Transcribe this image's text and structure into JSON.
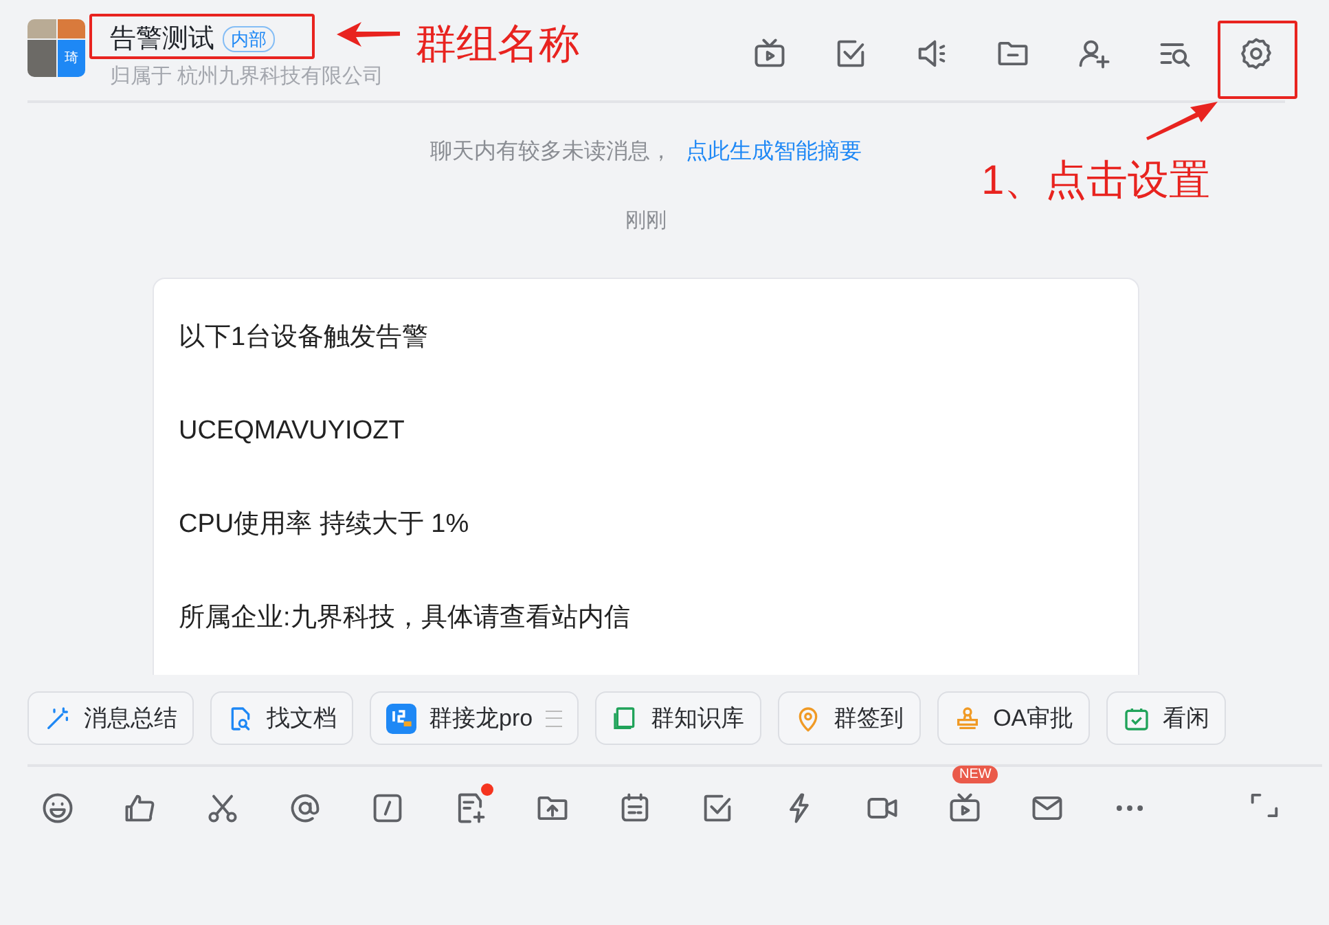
{
  "header": {
    "avatar_badge": "琦",
    "title": "告警测试",
    "tag": "内部",
    "subtitle": "归属于 杭州九界科技有限公司"
  },
  "chat": {
    "notice": "聊天内有较多未读消息，",
    "notice_link": "点此生成智能摘要",
    "time": "刚刚",
    "card_lines": [
      "以下1台设备触发告警",
      "UCEQMAVUYIOZT",
      "CPU使用率 持续大于 1%",
      "所属企业:九界科技，具体请查看站内信"
    ]
  },
  "quick_actions": [
    {
      "label": "消息总结"
    },
    {
      "label": "找文档"
    },
    {
      "label": "群接龙pro"
    },
    {
      "label": "群知识库"
    },
    {
      "label": "群签到"
    },
    {
      "label": "OA审批"
    },
    {
      "label": "看闲"
    }
  ],
  "toolbar": {
    "new_badge": "NEW"
  },
  "annotations": {
    "title_label": "群组名称",
    "settings_label": "1、点击设置"
  }
}
